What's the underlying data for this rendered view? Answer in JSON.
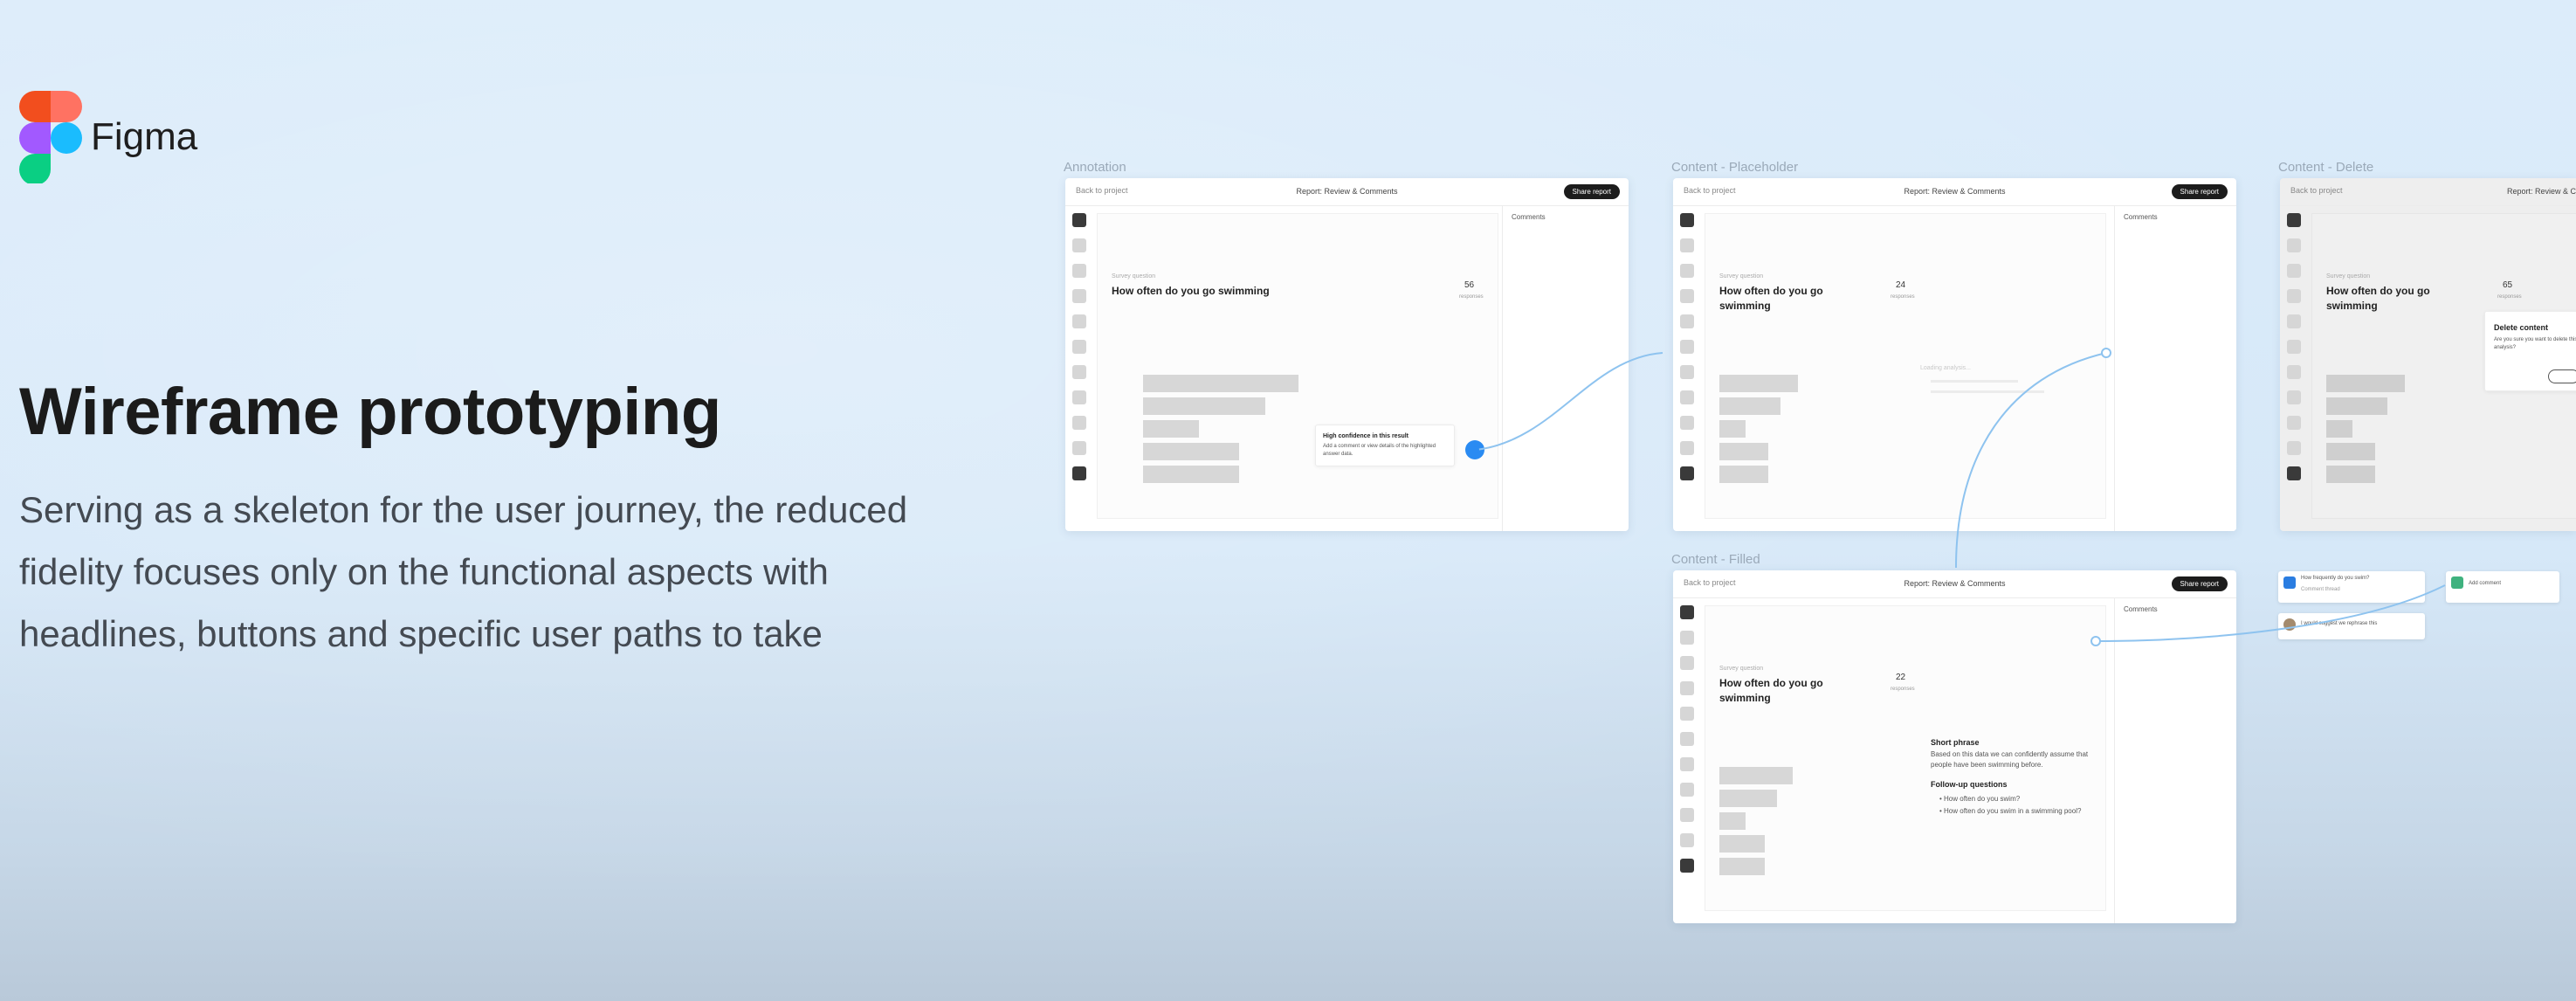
{
  "brand": {
    "name": "Figma",
    "icon": "figma-logo-icon"
  },
  "hero": {
    "title": "Wireframe prototyping",
    "description": "Serving as a skeleton for the user journey, the reduced fidelity focuses only on the functional aspects with headlines, buttons and specific user paths to take"
  },
  "colors": {
    "background": "#d8eaf9",
    "title": "#1b1b1b",
    "description": "#444a52",
    "connector": "#7ab8ee",
    "accent_dot": "#2a8bf2",
    "logo_red": "#f24e1e",
    "logo_orange": "#ff7262",
    "logo_purple": "#a259ff",
    "logo_blue": "#1abcfe",
    "logo_green": "#0acf83"
  },
  "canvas": {
    "frames": [
      {
        "label": "Annotation",
        "back": "Back to project",
        "title": "Report: Review & Comments",
        "action": "Share report",
        "side_title": "Comments",
        "question_small": "Survey question",
        "question": "How often do you go swimming",
        "count": "56",
        "count_label": "responses",
        "annotation_title": "High confidence in this result",
        "annotation_text": "Add a comment or view details of the highlighted answer data."
      },
      {
        "label": "Content - Placeholder",
        "back": "Back to project",
        "title": "Report: Review & Comments",
        "action": "Share report",
        "side_title": "Comments",
        "question_small": "Survey question",
        "question": "How often do you go swimming",
        "count": "24",
        "count_label": "responses",
        "placeholder": "Loading analysis..."
      },
      {
        "label": "Content - Delete",
        "back": "Back to project",
        "title": "Report: Review & Com",
        "question_small": "Survey question",
        "question": "How often do you go swimming",
        "count": "65",
        "count_label": "responses",
        "dialog_title": "Delete content",
        "dialog_text": "Are you sure you want to delete this analysis?"
      },
      {
        "label": "Content - Filled",
        "back": "Back to project",
        "title": "Report: Review & Comments",
        "action": "Share report",
        "side_title": "Comments",
        "question_small": "Survey question",
        "question": "How often do you go swimming",
        "count": "22",
        "count_label": "responses",
        "heading": "Short phrase",
        "paragraph": "Based on this data we can confidently assume that people have been swimming before.",
        "followup_title": "Follow-up questions",
        "followups": [
          "How often do you swim?",
          "How often do you swim in a swimming pool?"
        ]
      }
    ],
    "comments": [
      {
        "text": "How frequently do you swim?",
        "sub": "Comment thread"
      },
      {
        "text": "Add comment",
        "sub": ""
      },
      {
        "text": "I would suggest we rephrase this",
        "sub": ""
      }
    ]
  }
}
